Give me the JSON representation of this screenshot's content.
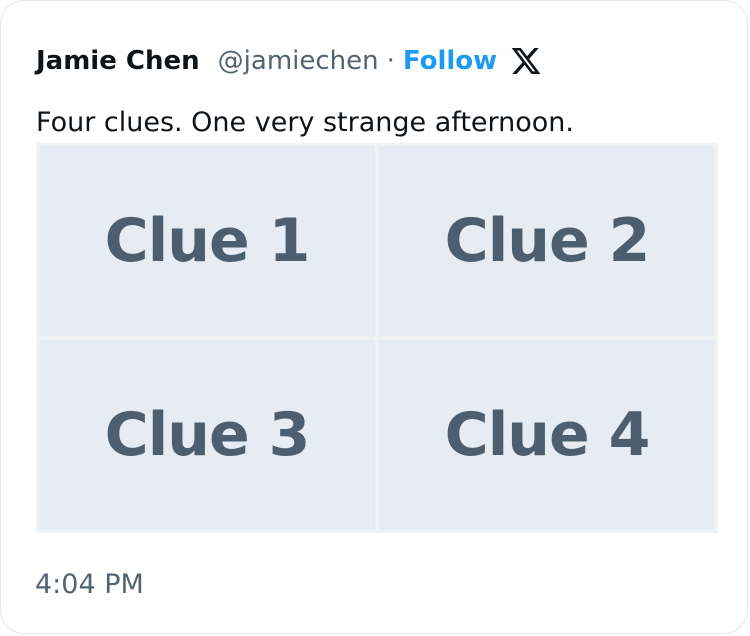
{
  "tweet": {
    "author_name": "Jamie Chen",
    "handle": "@jamiechen",
    "separator": "·",
    "follow_label": "Follow",
    "text": "Four clues. One very strange afternoon.",
    "timestamp": "4:04 PM",
    "images": [
      {
        "label": "Clue 1"
      },
      {
        "label": "Clue 2"
      },
      {
        "label": "Clue 3"
      },
      {
        "label": "Clue 4"
      }
    ]
  },
  "icons": {
    "brand": "x-logo-icon"
  },
  "colors": {
    "accent": "#1d9bf0",
    "text_primary": "#0f1419",
    "text_secondary": "#536471",
    "image_bg": "#e6ecf3",
    "image_text": "#4d5f6e"
  }
}
